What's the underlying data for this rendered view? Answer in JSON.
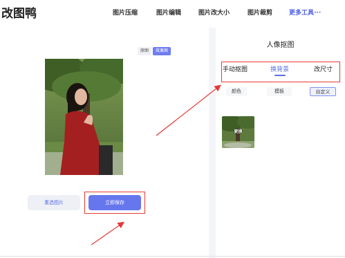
{
  "header": {
    "logo": "改图鸭",
    "nav": [
      "图片压缩",
      "图片编辑",
      "图片改大小",
      "图片裁剪"
    ],
    "more": "更多工具···"
  },
  "preview": {
    "toggle_original": "原图",
    "toggle_result": "效果图"
  },
  "actions": {
    "reselect": "重选图片",
    "save": "立即保存"
  },
  "side": {
    "title": "人像抠图",
    "tabs": [
      "手动抠图",
      "换背景",
      "改尺寸"
    ],
    "active_tab": "换背景",
    "subtabs": [
      "颜色",
      "模板",
      "自定义"
    ],
    "thumb_label": "更换"
  },
  "colors": {
    "accent": "#6677ee",
    "highlight": "#e53935"
  }
}
